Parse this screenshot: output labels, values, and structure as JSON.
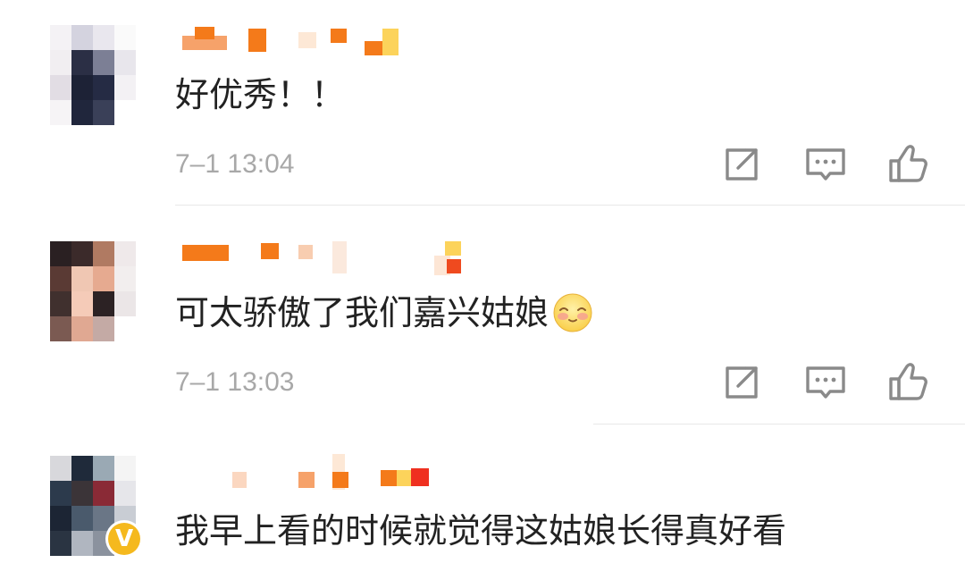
{
  "colors": {
    "text": "#222222",
    "timestamp": "#a8a8a8",
    "icon": "#8a8a8a",
    "divider": "#e8e8e8",
    "verified_badge": "#f5b91e",
    "username_blur": "#f47a1a"
  },
  "comments": [
    {
      "avatar": "blurred-avatar",
      "username": "",
      "text": "好优秀！！",
      "time": "7–1 13:04",
      "actions": [
        "share-icon",
        "reply-icon",
        "like-icon"
      ]
    },
    {
      "avatar": "blurred-avatar",
      "username": "",
      "text": "可太骄傲了我们嘉兴姑娘",
      "emoji": "shy-smile-emoji",
      "time": "7–1 13:03",
      "actions": [
        "share-icon",
        "reply-icon",
        "like-icon"
      ]
    },
    {
      "avatar": "blurred-avatar",
      "username": "",
      "verified": true,
      "verified_label": "V",
      "text": "我早上看的时候就觉得这姑娘长得真好看",
      "actions": []
    }
  ]
}
